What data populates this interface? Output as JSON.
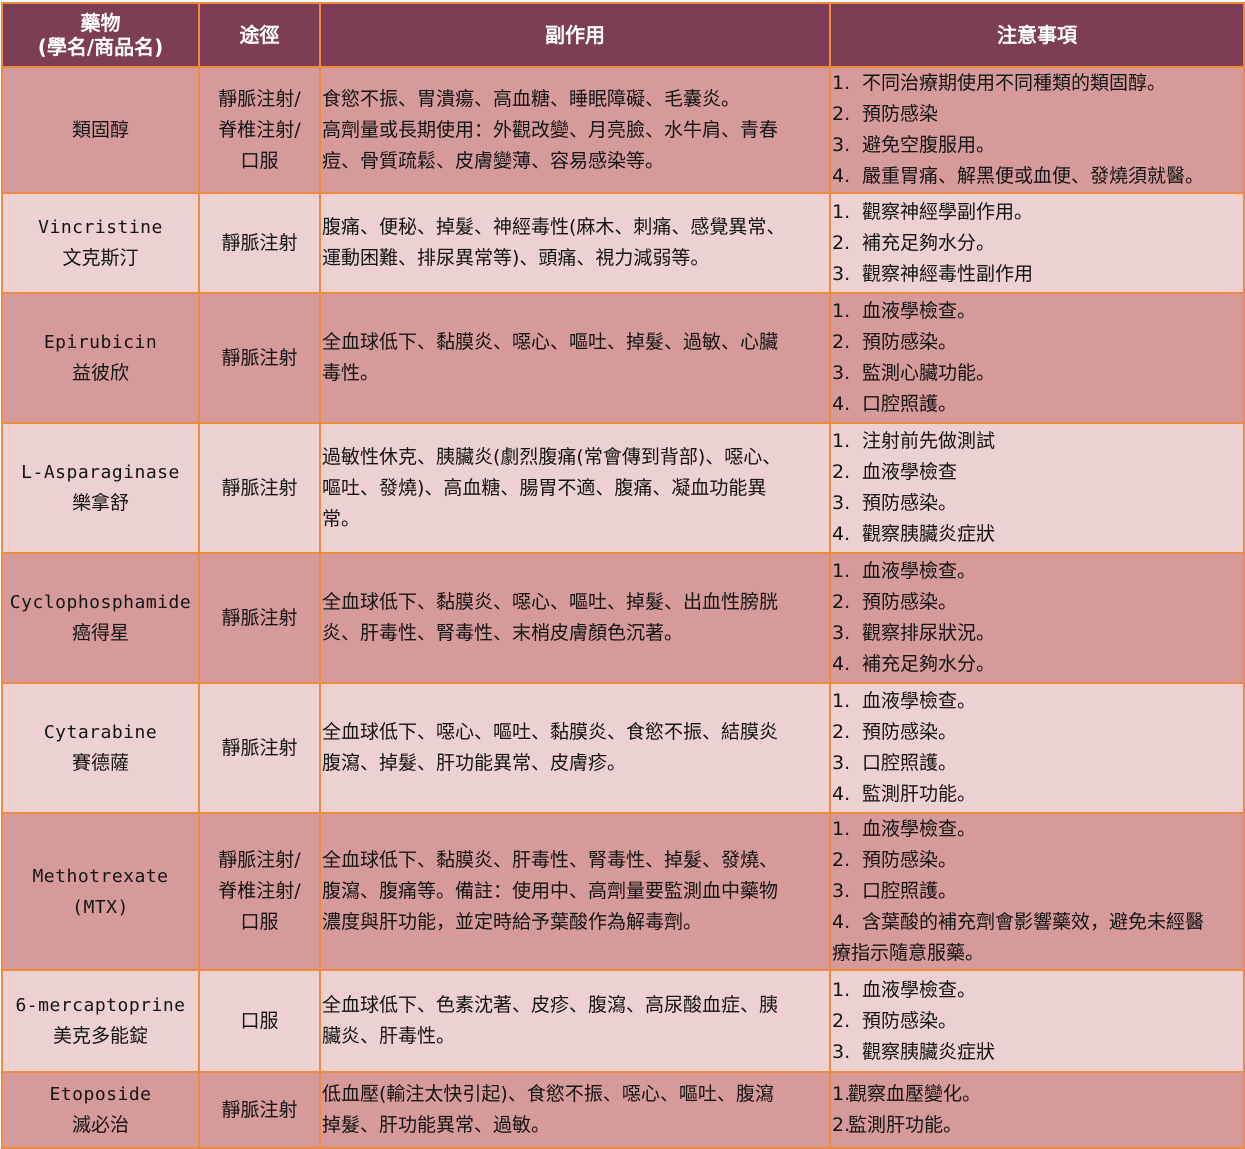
{
  "headers": {
    "drug_line1": "藥物",
    "drug_line2": "(學名/商品名)",
    "route": "途徑",
    "side_effects": "副作用",
    "notes": "注意事項"
  },
  "colors": {
    "header_bg": "#7d3d54",
    "row_dark": "#d79a9b",
    "row_light": "#ecd0d2",
    "border": "#ef8a3e"
  },
  "rows": [
    {
      "drug": [
        "類固醇"
      ],
      "route": [
        "靜脈注射/",
        "脊椎注射/",
        "口服"
      ],
      "side": [
        "食慾不振、胃潰瘍、高血糖、睡眠障礙、毛囊炎。",
        "高劑量或長期使用：外觀改變、月亮臉、水牛肩、青春",
        "痘、骨質疏鬆、皮膚變薄、容易感染等。"
      ],
      "notes": [
        {
          "num": "1.",
          "text": "不同治療期使用不同種類的類固醇。"
        },
        {
          "num": "2.",
          "text": "預防感染"
        },
        {
          "num": "3.",
          "text": "避免空腹服用。"
        },
        {
          "num": "4.",
          "text": "嚴重胃痛、解黑便或血便、發燒須就醫。"
        }
      ]
    },
    {
      "drug": [
        "Vincristine",
        "文克斯汀"
      ],
      "route": [
        "靜脈注射"
      ],
      "side": [
        "腹痛、便秘、掉髮、神經毒性(麻木、刺痛、感覺異常、",
        "運動困難、排尿異常等)、頭痛、視力減弱等。"
      ],
      "notes": [
        {
          "num": "1.",
          "text": "觀察神經學副作用。"
        },
        {
          "num": "2.",
          "text": "補充足夠水分。"
        },
        {
          "num": "3.",
          "text": "觀察神經毒性副作用"
        }
      ]
    },
    {
      "drug": [
        "Epirubicin",
        "益彼欣"
      ],
      "route": [
        "靜脈注射"
      ],
      "side": [
        "全血球低下、黏膜炎、噁心、嘔吐、掉髮、過敏、心臟",
        "毒性。"
      ],
      "notes": [
        {
          "num": "1.",
          "text": "血液學檢查。"
        },
        {
          "num": "2.",
          "text": "預防感染。"
        },
        {
          "num": "3.",
          "text": "監測心臟功能。"
        },
        {
          "num": "4.",
          "text": "口腔照護。"
        }
      ]
    },
    {
      "drug": [
        "L-Asparaginase",
        "樂拿舒"
      ],
      "route": [
        "靜脈注射"
      ],
      "side": [
        "過敏性休克、胰臟炎(劇烈腹痛(常會傳到背部)、噁心、",
        "嘔吐、發燒)、高血糖、腸胃不適、腹痛、凝血功能異",
        "常。"
      ],
      "notes": [
        {
          "num": "1.",
          "text": "注射前先做測試"
        },
        {
          "num": "2.",
          "text": "血液學檢查"
        },
        {
          "num": "3.",
          "text": "預防感染。"
        },
        {
          "num": "4.",
          "text": "觀察胰臟炎症狀"
        }
      ]
    },
    {
      "drug": [
        "Cyclophosphamide",
        "癌得星"
      ],
      "route": [
        "靜脈注射"
      ],
      "side": [
        "全血球低下、黏膜炎、噁心、嘔吐、掉髮、出血性膀胱",
        "炎、肝毒性、腎毒性、末梢皮膚顏色沉著。"
      ],
      "notes": [
        {
          "num": "1.",
          "text": "血液學檢查。"
        },
        {
          "num": "2.",
          "text": "預防感染。"
        },
        {
          "num": "3.",
          "text": "觀察排尿狀況。"
        },
        {
          "num": "4.",
          "text": "補充足夠水分。"
        }
      ]
    },
    {
      "drug": [
        "Cytarabine",
        "賽德薩"
      ],
      "route": [
        "靜脈注射"
      ],
      "side": [
        "全血球低下、噁心、嘔吐、黏膜炎、食慾不振、結膜炎",
        "腹瀉、掉髮、肝功能異常、皮膚疹。"
      ],
      "notes": [
        {
          "num": "1.",
          "text": "血液學檢查。"
        },
        {
          "num": "2.",
          "text": "預防感染。"
        },
        {
          "num": "3.",
          "text": "口腔照護。"
        },
        {
          "num": "4.",
          "text": "監測肝功能。"
        }
      ]
    },
    {
      "drug": [
        "Methotrexate",
        "(MTX)"
      ],
      "route": [
        "靜脈注射/",
        "脊椎注射/",
        "口服"
      ],
      "side": [
        "全血球低下、黏膜炎、肝毒性、腎毒性、掉髮、發燒、",
        "腹瀉、腹痛等。備註：使用中、高劑量要監測血中藥物",
        "濃度與肝功能，並定時給予葉酸作為解毒劑。"
      ],
      "notes": [
        {
          "num": "1.",
          "text": "血液學檢查。"
        },
        {
          "num": "2.",
          "text": "預防感染。"
        },
        {
          "num": "3.",
          "text": "口腔照護。"
        },
        {
          "num": "4.",
          "text": "含葉酸的補充劑會影響藥效，避免未經醫"
        },
        {
          "num": "",
          "text": "療指示隨意服藥。"
        }
      ]
    },
    {
      "drug": [
        "6-mercaptoprine",
        "美克多能錠"
      ],
      "route": [
        "口服"
      ],
      "side": [
        "全血球低下、色素沈著、皮疹、腹瀉、高尿酸血症、胰",
        "臟炎、肝毒性。"
      ],
      "notes": [
        {
          "num": "1.",
          "text": "血液學檢查。"
        },
        {
          "num": "2.",
          "text": "預防感染。"
        },
        {
          "num": "3.",
          "text": "觀察胰臟炎症狀"
        }
      ]
    },
    {
      "drug": [
        "Etoposide",
        "滅必治"
      ],
      "route": [
        "靜脈注射"
      ],
      "side": [
        "低血壓(輸注太快引起)、食慾不振、噁心、嘔吐、腹瀉",
        "掉髮、肝功能異常、過敏。"
      ],
      "notes": [
        {
          "num": "1.",
          "text": "觀察血壓變化。"
        },
        {
          "num": "2.",
          "text": "監測肝功能。"
        }
      ]
    }
  ]
}
